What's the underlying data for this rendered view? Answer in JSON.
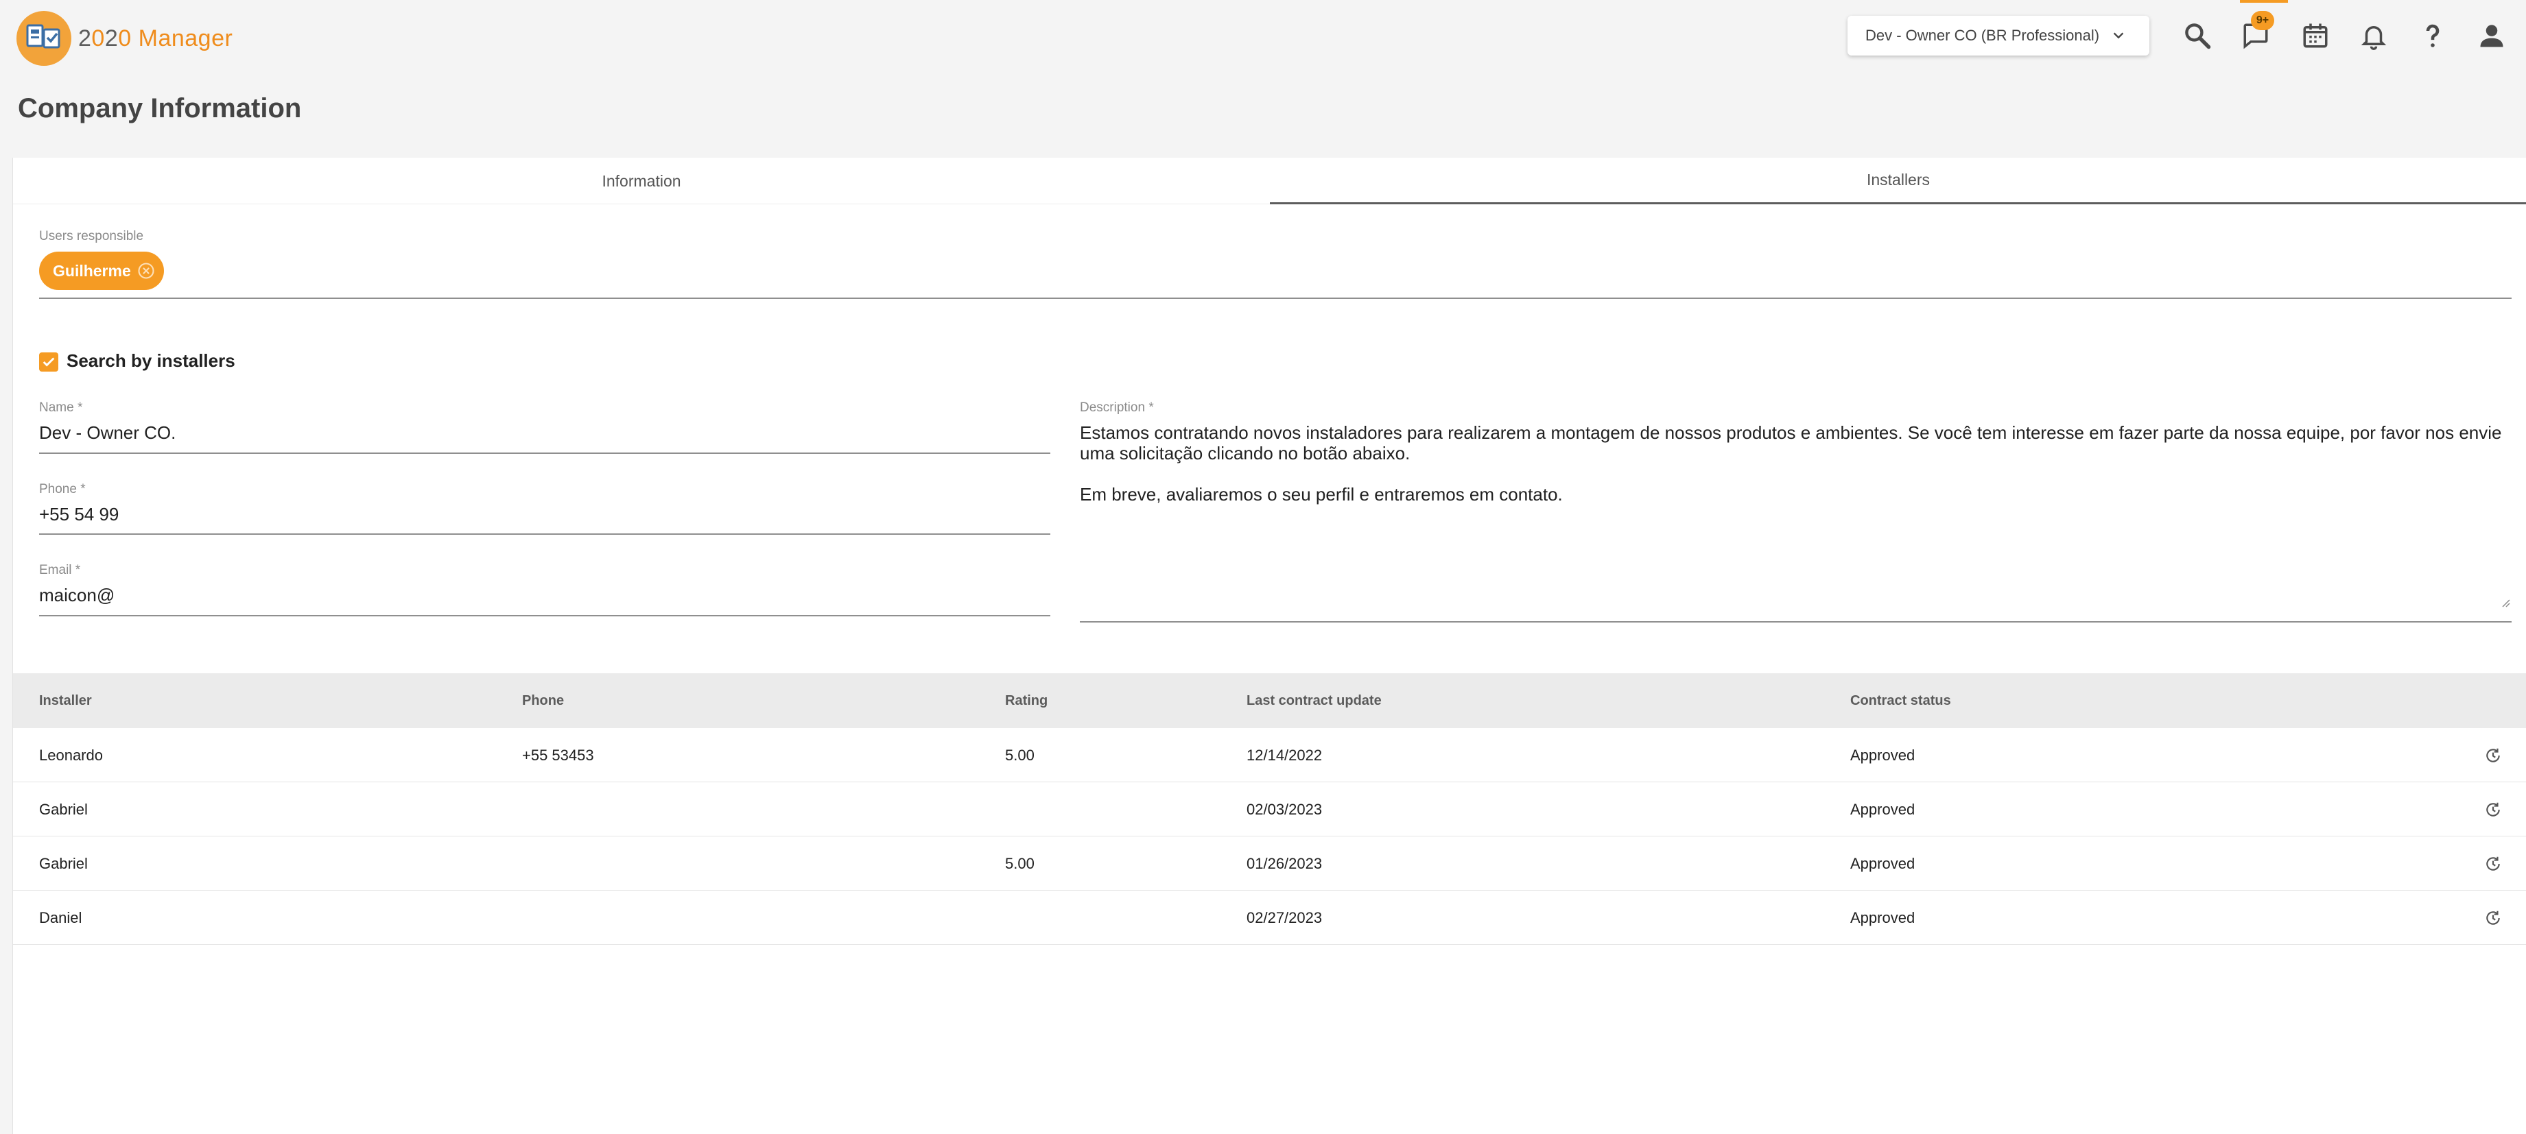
{
  "header": {
    "logo_prefix": "2",
    "logo_zero1": "0",
    "logo_mid": "2",
    "logo_zero2": "0",
    "logo_suffix": " Manager",
    "company_selector": "Dev - Owner CO (BR Professional)",
    "messages_badge": "9+",
    "icons": [
      "search-icon",
      "chat-icon",
      "calendar-icon",
      "bell-icon",
      "help-icon",
      "account-icon"
    ]
  },
  "page": {
    "title": "Company Information"
  },
  "tabs": [
    {
      "label": "Information",
      "active": false
    },
    {
      "label": "Installers",
      "active": true
    }
  ],
  "form": {
    "users_responsible_label": "Users responsible",
    "users_responsible": [
      "Guilherme"
    ],
    "search_by_installers_label": "Search by installers",
    "search_by_installers_checked": true,
    "name_label": "Name *",
    "name_value": "Dev - Owner CO.",
    "phone_label": "Phone *",
    "phone_value": "+55 54 99",
    "email_label": "Email *",
    "email_value": "maicon@",
    "description_label": "Description *",
    "description_p1": "Estamos contratando novos instaladores para realizarem a montagem de nossos produtos e ambientes. Se você tem interesse em fazer parte da nossa equipe, por favor nos envie uma solicitação clicando no botão abaixo.",
    "description_p2": "Em breve, avaliaremos o seu perfil e entraremos em contato."
  },
  "table": {
    "columns": [
      "Installer",
      "Phone",
      "Rating",
      "Last contract update",
      "Contract status"
    ],
    "rows": [
      {
        "installer": "Leonardo",
        "phone": "+55 53453",
        "rating": "5.00",
        "last_update": "12/14/2022",
        "status": "Approved"
      },
      {
        "installer": "Gabriel",
        "phone": "",
        "rating": "",
        "last_update": "02/03/2023",
        "status": "Approved"
      },
      {
        "installer": "Gabriel",
        "phone": "",
        "rating": "5.00",
        "last_update": "01/26/2023",
        "status": "Approved"
      },
      {
        "installer": "Daniel",
        "phone": "",
        "rating": "",
        "last_update": "02/27/2023",
        "status": "Approved"
      }
    ]
  },
  "colors": {
    "accent": "#f59b23",
    "logo_orange": "#ef8c1c",
    "header_bg": "#ebebeb"
  }
}
